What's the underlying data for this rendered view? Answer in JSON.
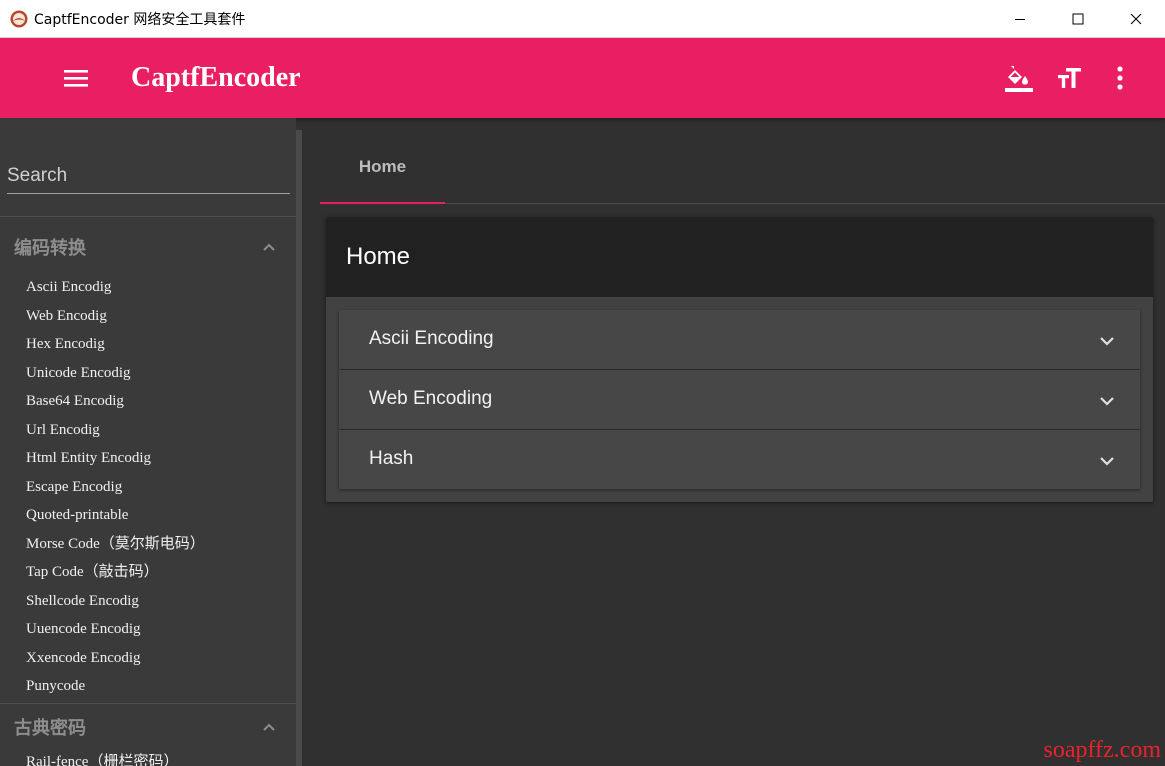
{
  "window": {
    "title": "CaptfEncoder 网络安全工具套件",
    "controls": [
      "minimize-icon",
      "maximize-icon",
      "close-icon"
    ]
  },
  "appbar": {
    "title": "CaptfEncoder",
    "color": "#e91e63",
    "icons": [
      "menu-icon",
      "format-color-fill-icon",
      "format-size-icon",
      "more-vert-icon"
    ]
  },
  "sidebar": {
    "search_placeholder": "Search",
    "sections": [
      {
        "title": "编码转换",
        "expanded": true,
        "items": [
          "Ascii Encodig",
          "Web Encodig",
          "Hex Encodig",
          "Unicode Encodig",
          "Base64 Encodig",
          "Url Encodig",
          "Html Entity Encodig",
          "Escape Encodig",
          "Quoted-printable",
          "Morse Code（莫尔斯电码）",
          "Tap Code（敲击码）",
          "Shellcode Encodig",
          "Uuencode Encodig",
          "Xxencode Encodig",
          "Punycode"
        ]
      },
      {
        "title": "古典密码",
        "expanded": true,
        "items": [
          "Rail-fence（栅栏密码）"
        ]
      }
    ]
  },
  "main": {
    "tabs": [
      {
        "label": "Home",
        "active": true
      }
    ],
    "card": {
      "title": "Home",
      "panels": [
        "Ascii Encoding",
        "Web Encoding",
        "Hash"
      ]
    }
  },
  "watermark": "soapffz.com"
}
